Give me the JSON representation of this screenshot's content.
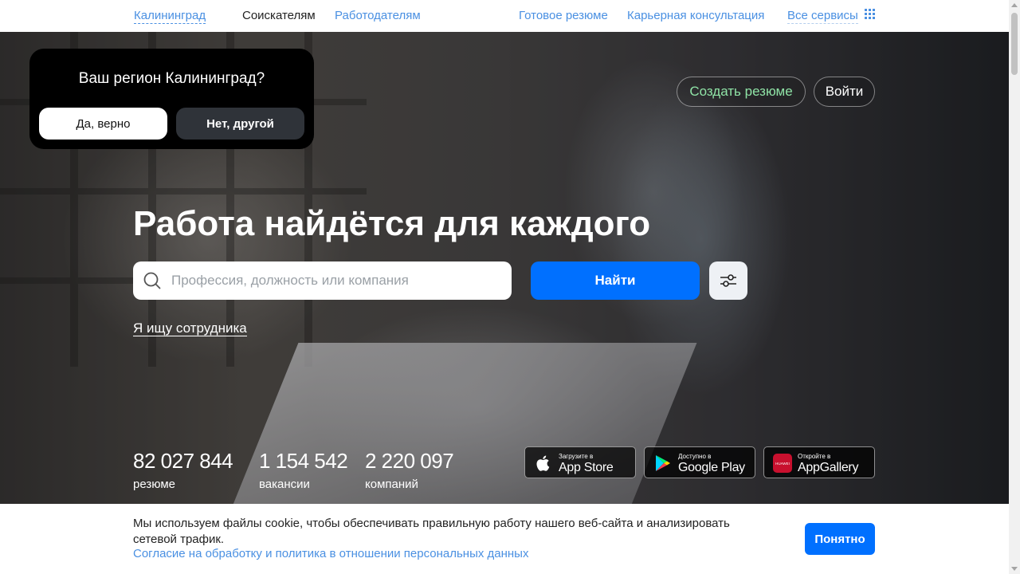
{
  "nav": {
    "region": "Калининград",
    "seekers": "Соискателям",
    "employers": "Работодателям",
    "ready_resume": "Готовое резюме",
    "career": "Карьерная консультация",
    "all_services": "Все сервисы",
    "all_services_icon": "grid-icon"
  },
  "region_popup": {
    "question": "Ваш регион Калининград?",
    "yes": "Да, верно",
    "no": "Нет, другой"
  },
  "header_buttons": {
    "create_resume": "Создать резюме",
    "login": "Войти"
  },
  "hero": {
    "title": "Работа найдётся для каждого",
    "search_placeholder": "Профессия, должность или компания",
    "search_value": "",
    "find_button": "Найти",
    "employer_link": "Я ищу сотрудника"
  },
  "stats": [
    {
      "value": "82 027 844",
      "label": "резюме"
    },
    {
      "value": "1 154 542",
      "label": "вакансии"
    },
    {
      "value": "2 220 097",
      "label": "компаний"
    }
  ],
  "stores": [
    {
      "small": "Загрузите в",
      "big": "App Store",
      "icon": "apple-icon"
    },
    {
      "small": "Доступно в",
      "big": "Google Play",
      "icon": "google-play-icon"
    },
    {
      "small": "Откройте в",
      "big": "AppGallery",
      "icon": "huawei-icon",
      "icon_text": "HUAWEI"
    }
  ],
  "cookie": {
    "text": "Мы используем файлы cookie, чтобы обеспечивать правильную работу нашего веб-сайта и анализировать сетевой трафик.",
    "link": "Согласие на обработку и политика в отношении персональных данных",
    "button": "Понятно"
  },
  "colors": {
    "accent": "#0070ff",
    "link": "#4a90e2",
    "create_resume": "#8fe3a6",
    "popup_bg": "#000000"
  }
}
